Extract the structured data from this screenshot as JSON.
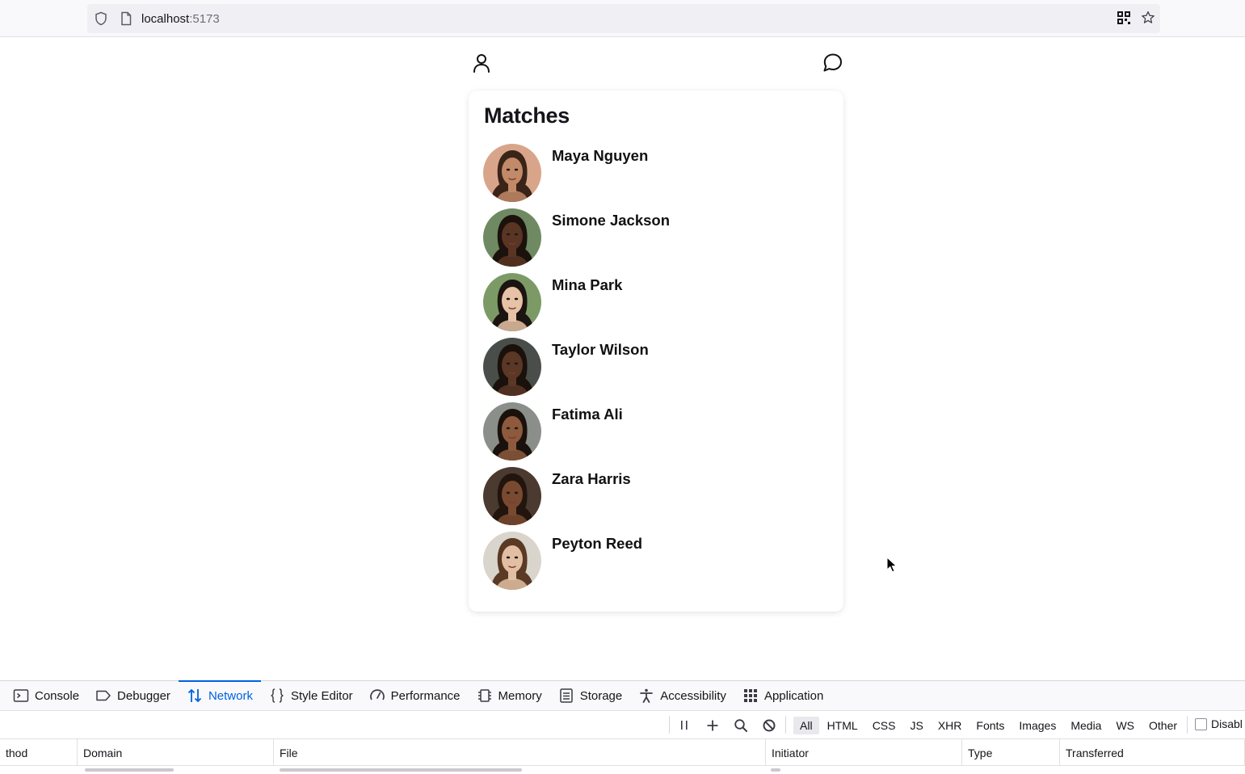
{
  "browser": {
    "url_host": "localhost",
    "url_port": ":5173"
  },
  "page": {
    "title": "Matches",
    "matches": [
      {
        "name": "Maya Nguyen",
        "skin": "#c28a68",
        "hair": "#3a2418",
        "bg": "#d9a58a"
      },
      {
        "name": "Simone Jackson",
        "skin": "#5a3523",
        "hair": "#1b120d",
        "bg": "#6f8a62"
      },
      {
        "name": "Mina Park",
        "skin": "#e6c2a6",
        "hair": "#1c1410",
        "bg": "#7c9a66"
      },
      {
        "name": "Taylor Wilson",
        "skin": "#5b3726",
        "hair": "#1a110c",
        "bg": "#4a4e4a"
      },
      {
        "name": "Fatima Ali",
        "skin": "#8d5a3d",
        "hair": "#1a110c",
        "bg": "#8a8f8a"
      },
      {
        "name": "Zara Harris",
        "skin": "#7a4a30",
        "hair": "#21150e",
        "bg": "#4b3a30"
      },
      {
        "name": "Peyton Reed",
        "skin": "#e2bfa2",
        "hair": "#5a3a24",
        "bg": "#d9d4cc"
      }
    ]
  },
  "devtools": {
    "tabs": [
      {
        "label": "Console",
        "icon": "console-icon"
      },
      {
        "label": "Debugger",
        "icon": "debugger-icon"
      },
      {
        "label": "Network",
        "icon": "network-icon",
        "active": true
      },
      {
        "label": "Style Editor",
        "icon": "style-editor-icon"
      },
      {
        "label": "Performance",
        "icon": "performance-icon"
      },
      {
        "label": "Memory",
        "icon": "memory-icon"
      },
      {
        "label": "Storage",
        "icon": "storage-icon"
      },
      {
        "label": "Accessibility",
        "icon": "accessibility-icon"
      },
      {
        "label": "Application",
        "icon": "application-icon"
      }
    ],
    "filters": [
      "All",
      "HTML",
      "CSS",
      "JS",
      "XHR",
      "Fonts",
      "Images",
      "Media",
      "WS",
      "Other"
    ],
    "disable_cache_label": "Disabl",
    "columns": [
      "thod",
      "Domain",
      "File",
      "Initiator",
      "Type",
      "Transferred"
    ],
    "accent": "#0061e0"
  }
}
